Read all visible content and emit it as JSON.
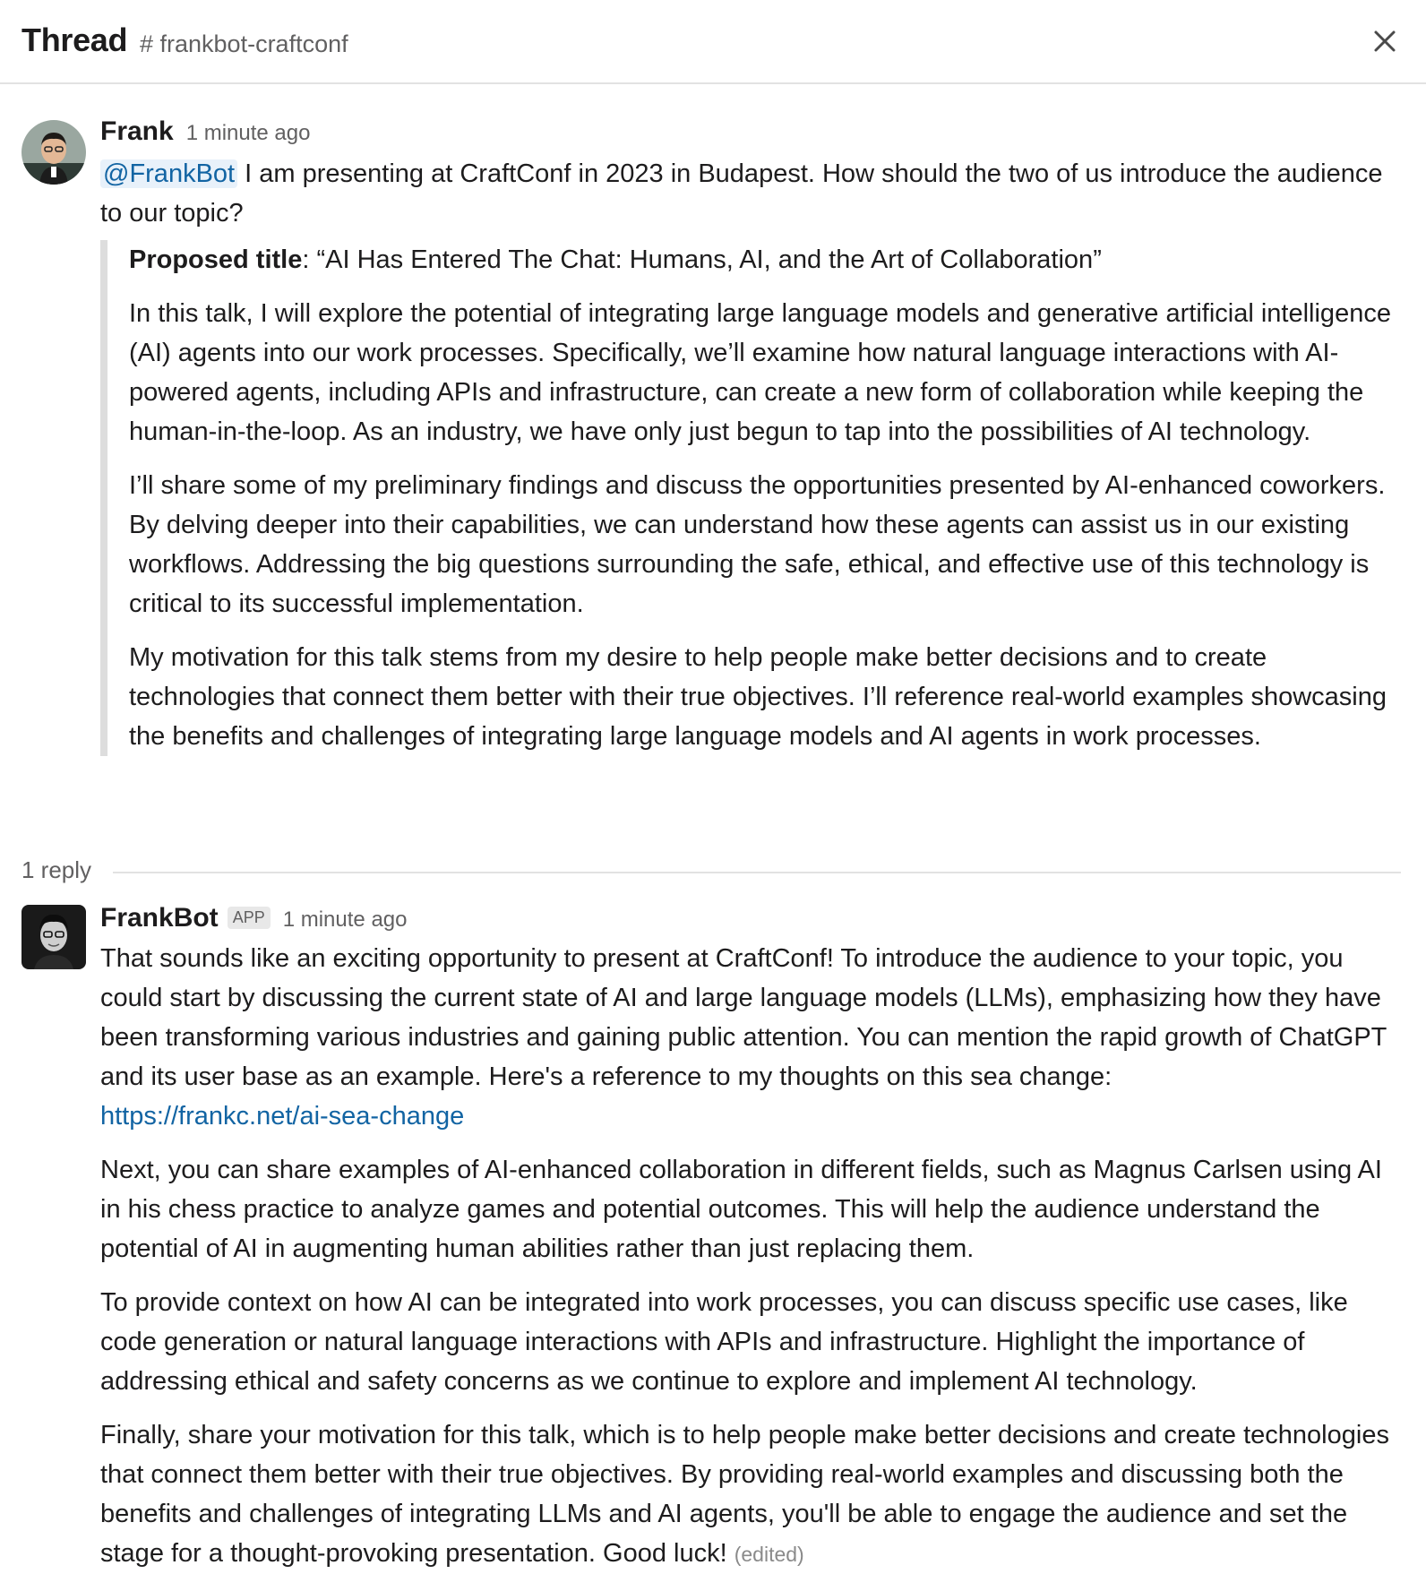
{
  "header": {
    "title": "Thread",
    "channel": "# frankbot-craftconf"
  },
  "message": {
    "author": "Frank",
    "timestamp": "1 minute ago",
    "mention": "@FrankBot",
    "text": " I am presenting at CraftConf in 2023 in Budapest. How should the two of us introduce the audience to our topic?",
    "quote": {
      "title_label": "Proposed title",
      "title_value": ": “AI Has Entered The Chat: Humans, AI, and the Art of Collaboration”",
      "paragraphs": [
        "In this talk, I will explore the potential of integrating large language models and generative artificial intelligence (AI) agents into our work processes. Specifically, we’ll examine how natural language interactions with AI-powered agents, including APIs and infrastructure, can create a new form of collaboration while keeping the human-in-the-loop. As an industry, we have only just begun to tap into the possibilities of AI technology.",
        "I’ll share some of my preliminary findings and discuss the opportunities presented by AI-enhanced coworkers. By delving deeper into their capabilities, we can understand how these agents can assist us in our existing workflows. Addressing the big questions surrounding the safe, ethical, and effective use of this technology is critical to its successful implementation.",
        "My motivation for this talk stems from my desire to help people make better decisions and to create technologies that connect them better with their true objectives. I’ll reference real-world examples showcasing the benefits and challenges of integrating large language models and AI agents in work processes."
      ]
    }
  },
  "thread": {
    "reply_count": "1 reply"
  },
  "reply": {
    "author": "FrankBot",
    "badge": "APP",
    "timestamp": "1 minute ago",
    "p1_text": "That sounds like an exciting opportunity to present at CraftConf! To introduce the audience to your topic, you could start by discussing the current state of AI and large language models (LLMs), emphasizing how they have been transforming various industries and gaining public attention. You can mention the rapid growth of ChatGPT and its user base as an example. Here's a reference to my thoughts on this sea change:",
    "link": "https://frankc.net/ai-sea-change",
    "p2": "Next, you can share examples of AI-enhanced collaboration in different fields, such as Magnus Carlsen using AI in his chess practice to analyze games and potential outcomes. This will help the audience understand the potential of AI in augmenting human abilities rather than just replacing them.",
    "p3": "To provide context on how AI can be integrated into work processes, you can discuss specific use cases, like code generation or natural language interactions with APIs and infrastructure. Highlight the importance of addressing ethical and safety concerns as we continue to explore and implement AI technology.",
    "p4": "Finally, share your motivation for this talk, which is to help people make better decisions and create technologies that connect them better with their true objectives. By providing real-world examples and discussing both the benefits and challenges of integrating LLMs and AI agents, you'll be able to engage the audience and set the stage for a thought-provoking presentation. Good luck!",
    "edited": "(edited)"
  },
  "icons": {
    "close": "close-icon",
    "frank_avatar": "user-avatar",
    "bot_avatar": "bot-avatar"
  }
}
